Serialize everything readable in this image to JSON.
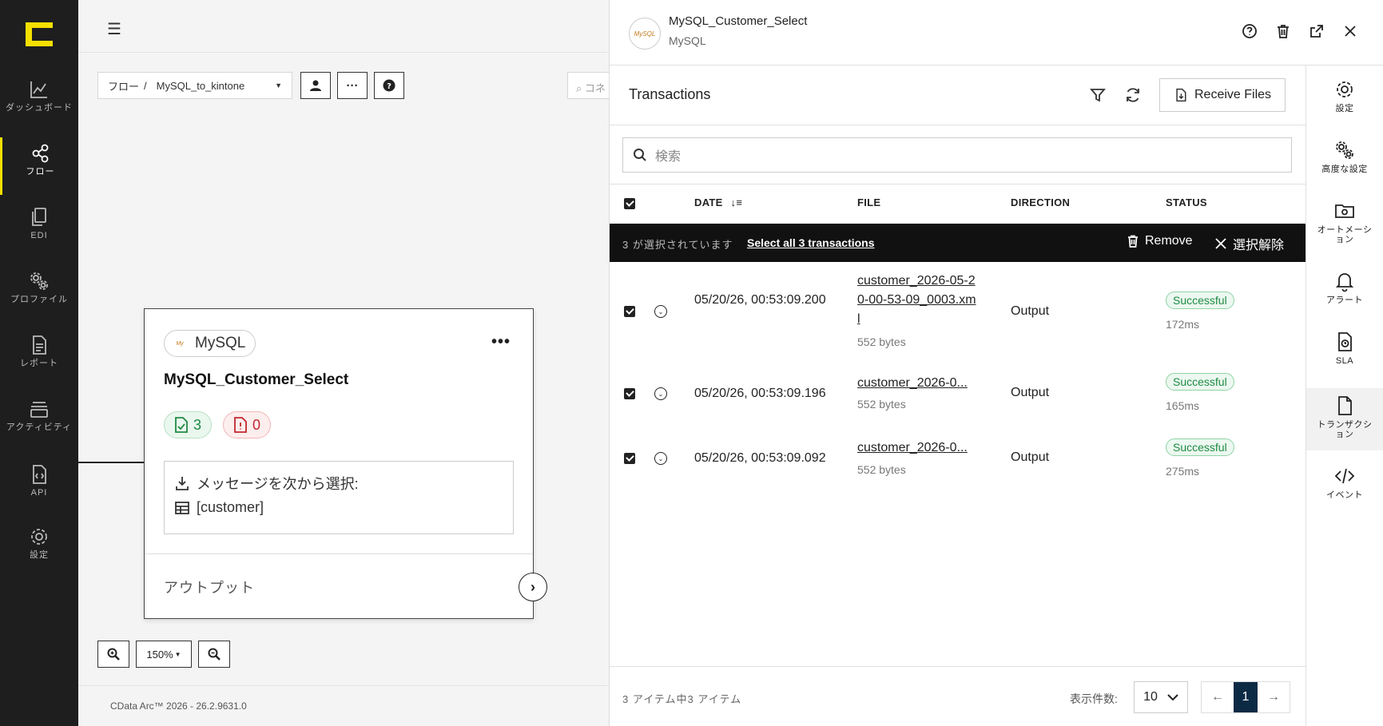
{
  "nav": {
    "items": [
      {
        "label": "ダッシュボード",
        "icon": "chart-line-icon"
      },
      {
        "label": "フロー",
        "icon": "share-nodes-icon"
      },
      {
        "label": "EDI",
        "icon": "documents-icon"
      },
      {
        "label": "プロファイル",
        "icon": "gears-icon"
      },
      {
        "label": "レポート",
        "icon": "report-icon"
      },
      {
        "label": "アクティビティ",
        "icon": "stack-icon"
      },
      {
        "label": "API",
        "icon": "api-icon"
      },
      {
        "label": "設定",
        "icon": "gear-icon"
      }
    ]
  },
  "canvas": {
    "breadcrumb_root": "フロー",
    "breadcrumb_sep": "/",
    "flow_name": "MySQL_to_kintone",
    "search_placeholder": "コネ",
    "zoom_level": "150%",
    "footer": "CData Arc™ 2026 - 26.2.9631.0"
  },
  "node": {
    "chip_label": "MySQL",
    "title": "MySQL_Customer_Select",
    "success_count": "3",
    "error_count": "0",
    "message_label": "メッセージを次から選択:",
    "table_label": "[customer]",
    "output_label": "アウトプット"
  },
  "panel": {
    "connector_name": "MySQL_Customer_Select",
    "connector_type": "MySQL",
    "section_title": "Transactions",
    "receive_files": "Receive Files",
    "search_placeholder": "検索",
    "columns": {
      "date": "DATE",
      "file": "FILE",
      "direction": "DIRECTION",
      "status": "STATUS"
    },
    "selection": {
      "count_text": "3 が選択されています",
      "select_all": "Select all 3 transactions",
      "remove": "Remove",
      "clear": "選択解除"
    },
    "rows": [
      {
        "date": "05/20/26, 00:53:09.200",
        "file": "customer_2026-05-20-00-53-09_0003.xml",
        "size": "552 bytes",
        "direction": "Output",
        "status": "Successful",
        "duration": "172ms"
      },
      {
        "date": "05/20/26, 00:53:09.196",
        "file": "customer_2026-0...",
        "size": "552 bytes",
        "direction": "Output",
        "status": "Successful",
        "duration": "165ms"
      },
      {
        "date": "05/20/26, 00:53:09.092",
        "file": "customer_2026-0...",
        "size": "552 bytes",
        "direction": "Output",
        "status": "Successful",
        "duration": "275ms"
      }
    ],
    "footer": {
      "count_text": "3 アイテム中3 アイテム",
      "per_page_label": "表示件数:",
      "per_page": "10",
      "current_page": "1"
    }
  },
  "rail": {
    "items": [
      {
        "label": "設定",
        "icon": "gear-icon"
      },
      {
        "label": "高度な設定",
        "icon": "gears-icon"
      },
      {
        "label": "オートメーション",
        "icon": "folder-gear-icon"
      },
      {
        "label": "アラート",
        "icon": "bell-icon"
      },
      {
        "label": "SLA",
        "icon": "sla-doc-icon"
      },
      {
        "label": "トランザクション",
        "icon": "document-icon"
      },
      {
        "label": "イベント",
        "icon": "code-icon"
      }
    ]
  },
  "colors": {
    "accent": "#f5e000",
    "nav_bg": "#1e1e1e",
    "success": "#1e8b43",
    "error": "#c0272d",
    "page_active": "#0d2a45"
  }
}
